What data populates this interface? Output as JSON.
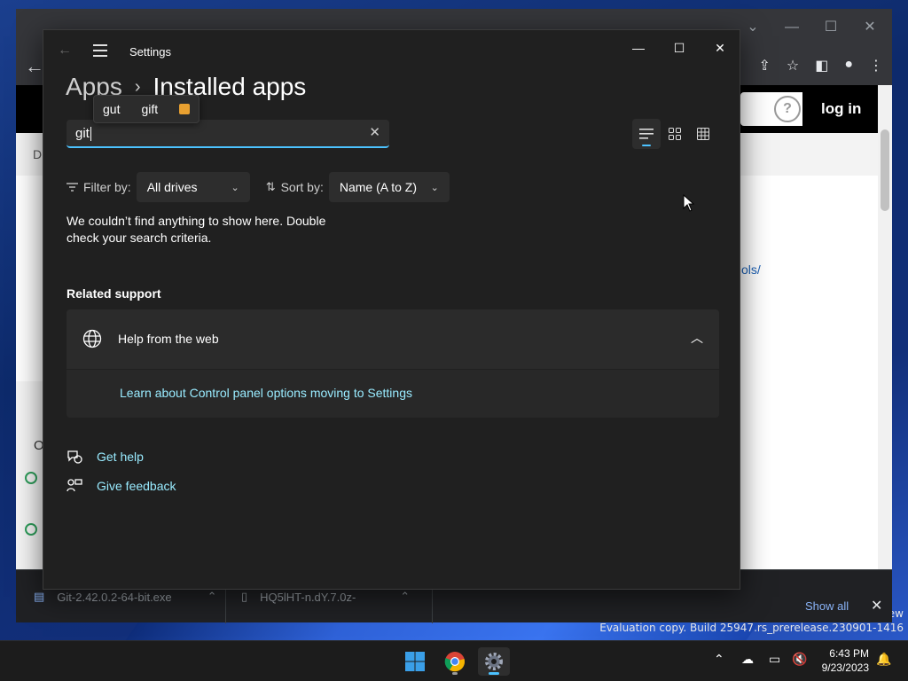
{
  "desktop": {
    "watermark_prefix": "ew",
    "watermark": "Evaluation copy. Build 25947.rs_prerelease.230901-1416"
  },
  "chrome": {
    "min_icon": "—",
    "max_icon": "☐",
    "close_icon": "✕",
    "login": "log in",
    "help": "?",
    "link_fragment": "ols/",
    "letter_d": "D",
    "letter_o": "O",
    "downloads": [
      {
        "name": "Git-2.42.0.2-64-bit.exe"
      },
      {
        "name": "HQ5lHT-n.dY.7.0z-"
      }
    ],
    "show_all": "Show all"
  },
  "settings": {
    "title": "Settings",
    "breadcrumb": {
      "parent": "Apps",
      "separator": "›",
      "current": "Installed apps"
    },
    "ime_candidates": [
      "gut",
      "gift"
    ],
    "search": {
      "value": "git",
      "clear_icon": "✕"
    },
    "filter": {
      "label": "Filter by:",
      "value": "All drives"
    },
    "sort": {
      "label": "Sort by:",
      "value": "Name (A to Z)"
    },
    "empty_message": "We couldn’t find anything to show here. Double check your search criteria.",
    "related_support": {
      "title": "Related support",
      "card_title": "Help from the web",
      "card_link": "Learn about Control panel options moving to Settings"
    },
    "footer": {
      "get_help": "Get help",
      "give_feedback": "Give feedback"
    }
  },
  "taskbar": {
    "time": "6:43 PM",
    "date": "9/23/2023"
  },
  "colors": {
    "accent": "#4cc2ff",
    "link": "#99ebff",
    "settings_bg": "#202020",
    "card_bg": "#2b2b2b"
  }
}
